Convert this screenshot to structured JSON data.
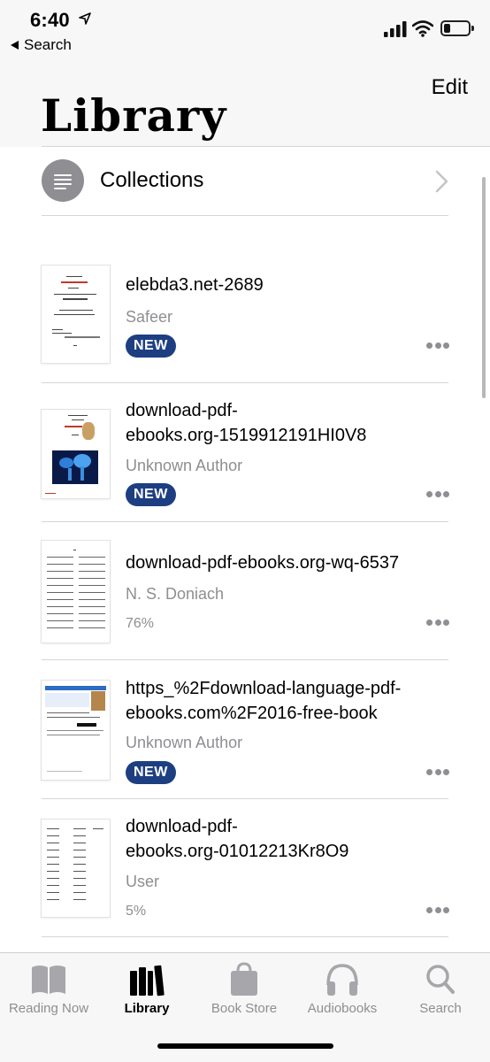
{
  "status_bar": {
    "time": "6:40",
    "back_label": "Search"
  },
  "nav": {
    "edit_label": "Edit",
    "title": "Library"
  },
  "collections": {
    "label": "Collections"
  },
  "books": [
    {
      "title": "elebda3.net-2689",
      "author": "Safeer",
      "badge": "NEW",
      "progress": ""
    },
    {
      "title": "download-pdf-ebooks.org-1519912191HI0V8",
      "author": "Unknown Author",
      "badge": "NEW",
      "progress": ""
    },
    {
      "title": "download-pdf-ebooks.org-wq-6537",
      "author": "N. S. Doniach",
      "badge": "",
      "progress": "76%"
    },
    {
      "title": "https_%2Fdownload-language-pdf-ebooks.com%2F2016-free-book",
      "author": "Unknown Author",
      "badge": "NEW",
      "progress": ""
    },
    {
      "title": "download-pdf-ebooks.org-01012213Kr8O9",
      "author": "User",
      "badge": "",
      "progress": "5%"
    }
  ],
  "book_titles_display": [
    [
      "elebda3.net-2689"
    ],
    [
      "download-pdf-",
      "ebooks.org-1519912191HI0V8"
    ],
    [
      "download-pdf-ebooks.org-wq-6537"
    ],
    [
      "https_%2Fdownload-language-pdf-",
      "ebooks.com%2F2016-free-book"
    ],
    [
      "download-pdf-",
      "ebooks.org-01012213Kr8O9"
    ]
  ],
  "tab_bar": {
    "items": [
      {
        "label": "Reading Now",
        "icon": "book-open-icon",
        "active": false
      },
      {
        "label": "Library",
        "icon": "books-stack-icon",
        "active": true
      },
      {
        "label": "Book Store",
        "icon": "shopping-bag-icon",
        "active": false
      },
      {
        "label": "Audiobooks",
        "icon": "headphones-icon",
        "active": false
      },
      {
        "label": "Search",
        "icon": "search-icon",
        "active": false
      }
    ]
  },
  "colors": {
    "badge": "#1d3f82",
    "secondary_text": "#8e8e93",
    "header_bg": "#f7f7f7"
  }
}
